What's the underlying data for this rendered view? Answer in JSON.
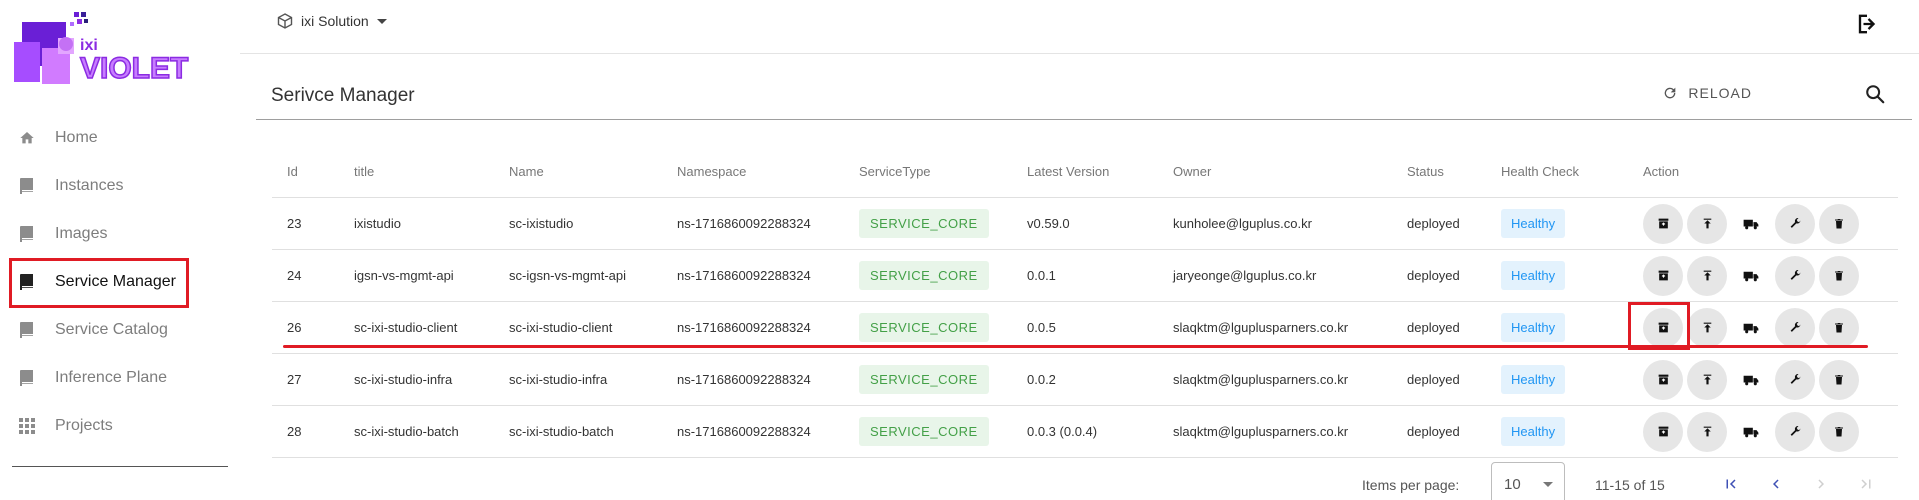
{
  "app": {
    "logo_prefix": "ixi",
    "logo_name": "VIOLET"
  },
  "sidebar": {
    "items": [
      {
        "label": "Home",
        "icon": "home-icon",
        "active": false
      },
      {
        "label": "Instances",
        "icon": "book-icon",
        "active": false
      },
      {
        "label": "Images",
        "icon": "book-icon",
        "active": false
      },
      {
        "label": "Service Manager",
        "icon": "book-icon",
        "active": true
      },
      {
        "label": "Service Catalog",
        "icon": "book-icon",
        "active": false
      },
      {
        "label": "Inference Plane",
        "icon": "book-icon",
        "active": false
      },
      {
        "label": "Projects",
        "icon": "apps-grid-icon",
        "active": false
      }
    ]
  },
  "topbar": {
    "solution_label": "ixi Solution"
  },
  "page": {
    "title": "Serivce Manager",
    "reload_label": "RELOAD"
  },
  "table": {
    "headers": {
      "id": "Id",
      "title": "title",
      "name": "Name",
      "namespace": "Namespace",
      "service_type": "ServiceType",
      "latest_version": "Latest Version",
      "owner": "Owner",
      "status": "Status",
      "health_check": "Health Check",
      "action": "Action"
    },
    "rows": [
      {
        "id": "23",
        "title": "ixistudio",
        "name": "sc-ixistudio",
        "namespace": "ns-1716860092288324",
        "service_type": "SERVICE_CORE",
        "latest_version": "v0.59.0",
        "owner": "kunholee@lguplus.co.kr",
        "status": "deployed",
        "health": "Healthy"
      },
      {
        "id": "24",
        "title": "igsn-vs-mgmt-api",
        "name": "sc-igsn-vs-mgmt-api",
        "namespace": "ns-1716860092288324",
        "service_type": "SERVICE_CORE",
        "latest_version": "0.0.1",
        "owner": "jaryeonge@lguplus.co.kr",
        "status": "deployed",
        "health": "Healthy"
      },
      {
        "id": "26",
        "title": "sc-ixi-studio-client",
        "name": "sc-ixi-studio-client",
        "namespace": "ns-1716860092288324",
        "service_type": "SERVICE_CORE",
        "latest_version": "0.0.5",
        "owner": "slaqktm@lguplusparners.co.kr",
        "status": "deployed",
        "health": "Healthy"
      },
      {
        "id": "27",
        "title": "sc-ixi-studio-infra",
        "name": "sc-ixi-studio-infra",
        "namespace": "ns-1716860092288324",
        "service_type": "SERVICE_CORE",
        "latest_version": "0.0.2",
        "owner": "slaqktm@lguplusparners.co.kr",
        "status": "deployed",
        "health": "Healthy"
      },
      {
        "id": "28",
        "title": "sc-ixi-studio-batch",
        "name": "sc-ixi-studio-batch",
        "namespace": "ns-1716860092288324",
        "service_type": "SERVICE_CORE",
        "latest_version": "0.0.3 (0.0.4)",
        "owner": "slaqktm@lguplusparners.co.kr",
        "status": "deployed",
        "health": "Healthy"
      }
    ],
    "action_icons": [
      "archive-icon",
      "upload-icon",
      "truck-icon",
      "wrench-icon",
      "trash-icon"
    ]
  },
  "pagination": {
    "items_per_page_label": "Items per page:",
    "items_per_page_value": "10",
    "range_label": "11-15 of 15"
  },
  "colors": {
    "brand_purple": "#8b2be2",
    "highlight_red": "#e01b24",
    "service_type_green": "#43a047",
    "healthy_blue": "#2196f3"
  }
}
